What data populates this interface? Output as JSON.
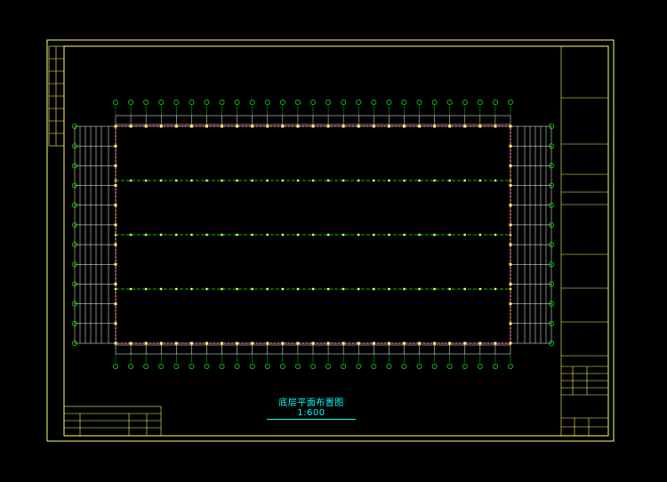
{
  "drawing": {
    "title": "底层平面布置图 1:600"
  },
  "colors": {
    "background": "#000000",
    "frame": "#ffff66",
    "structure": "#ffffff",
    "axis": "#00ff00",
    "text": "#00ffff",
    "columns": "#ff3333"
  },
  "grid": {
    "columns_top_count": 27,
    "rows_side_count": 12,
    "interior_lines": 3
  }
}
